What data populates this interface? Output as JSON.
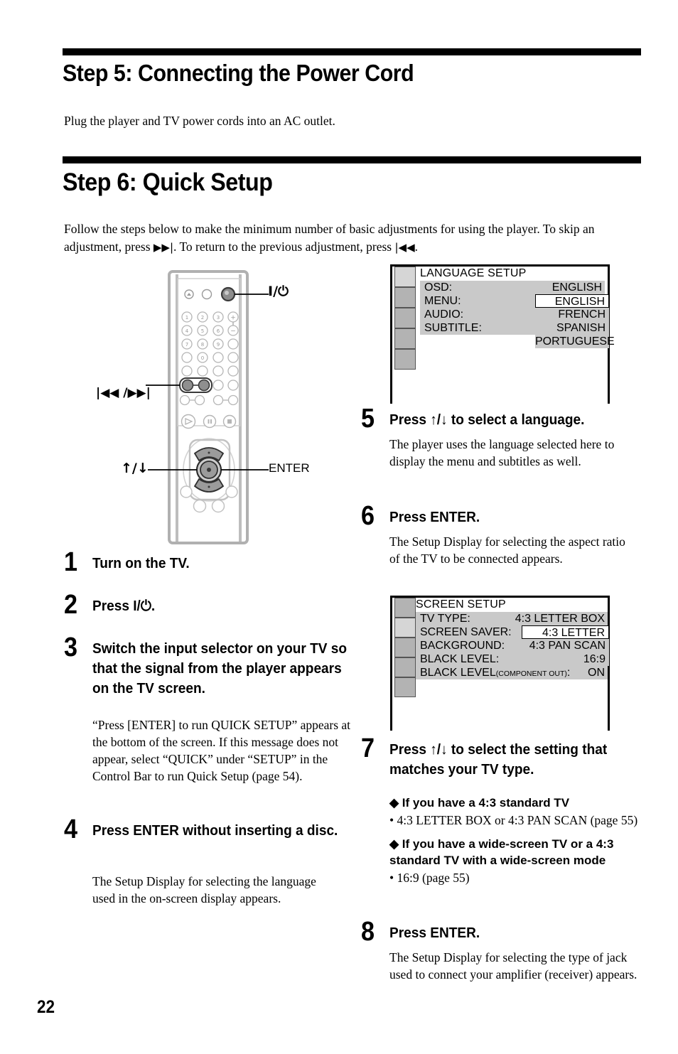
{
  "page": {
    "number": "22"
  },
  "section5": {
    "heading": "Step 5: Connecting the Power Cord",
    "body": "Plug the player and TV power cords into an AC outlet."
  },
  "section6": {
    "heading": "Step 6: Quick Setup",
    "intro_part1": "Follow the steps below to make the minimum number of basic adjustments for using the player. To skip an adjustment, press ",
    "intro_skip_symbol": "▶▶|",
    "intro_part2": ". To return to the previous adjustment, press ",
    "intro_back_symbol": "|◀◀",
    "intro_part3": "."
  },
  "remote_diagram": {
    "label_power": "I/⏻",
    "label_prev_next": "|◀◀ /▶▶|",
    "label_updown": "↑/↓",
    "label_enter": "ENTER",
    "keypad_digits": [
      "1",
      "2",
      "3",
      "4",
      "5",
      "6",
      "7",
      "8",
      "9",
      "0"
    ],
    "volume_plus": "+",
    "volume_minus": "−"
  },
  "steps": [
    {
      "num": "1",
      "title": "Turn on the TV.",
      "desc": ""
    },
    {
      "num": "2",
      "title": "Press I/⏻.",
      "desc": ""
    },
    {
      "num": "3",
      "title": "Switch the input selector on your TV so that the signal from the player appears on the TV screen.",
      "desc": "“Press [ENTER] to run QUICK SETUP” appears at the bottom of the screen. If this message does not appear, select “QUICK” under “SETUP” in the Control Bar to run Quick Setup (page 54)."
    },
    {
      "num": "4",
      "title": "Press ENTER without inserting a disc.",
      "desc": "The Setup Display for selecting the language used in the on-screen display appears."
    },
    {
      "num": "5",
      "title": "Press ↑/↓ to select a language.",
      "desc": "The player uses the language selected here to display the menu and subtitles as well."
    },
    {
      "num": "6",
      "title": "Press ENTER.",
      "desc": "The Setup Display for selecting the aspect ratio of the TV to be connected appears."
    },
    {
      "num": "7",
      "title": "Press ↑/↓ to select the setting that matches your TV type.",
      "desc": ""
    },
    {
      "num": "8",
      "title": "Press ENTER.",
      "desc": "The Setup Display for selecting the type of jack used to connect your amplifier (receiver) appears."
    }
  ],
  "step7_options": [
    {
      "diamond_heading": "◆ If you have a 4:3 standard TV",
      "bullet": "• 4:3 LETTER BOX or 4:3 PAN SCAN (page 55)"
    },
    {
      "diamond_heading": "◆ If you have a wide-screen TV or a 4:3 standard TV with a wide-screen mode",
      "bullet": "• 16:9 (page 55)"
    }
  ],
  "language_setup_screen": {
    "title": "LANGUAGE SETUP",
    "rows": [
      {
        "label": "OSD:",
        "value": "ENGLISH"
      },
      {
        "label": "MENU:",
        "value": ""
      },
      {
        "label": "AUDIO:",
        "value": ""
      },
      {
        "label": "SUBTITLE:",
        "value": ""
      }
    ],
    "dropdown": {
      "selected": "ENGLISH",
      "options": [
        "FRENCH",
        "SPANISH",
        "PORTUGUESE"
      ]
    }
  },
  "screen_setup_screen": {
    "title": "SCREEN SETUP",
    "rows": [
      {
        "label": "TV TYPE:",
        "label_small": "",
        "value": "4:3 LETTER BOX"
      },
      {
        "label": "SCREEN SAVER:",
        "label_small": "",
        "value": ""
      },
      {
        "label": "BACKGROUND:",
        "label_small": "",
        "value": ""
      },
      {
        "label": "BLACK LEVEL:",
        "label_small": "",
        "value": ""
      },
      {
        "label": "BLACK LEVEL",
        "label_small": "(COMPONENT OUT)",
        "label_tail": ":",
        "value": "ON"
      }
    ],
    "dropdown": {
      "selected": "4:3 LETTER BOX",
      "options": [
        "4:3 PAN SCAN",
        "16:9"
      ]
    }
  },
  "colors": {
    "osd_row_gray": "#c9c9c9",
    "osd_sidebar_gray": "#b3b3b3",
    "osd_sidebar_light": "#d6d6d6",
    "ink": "#000000"
  }
}
